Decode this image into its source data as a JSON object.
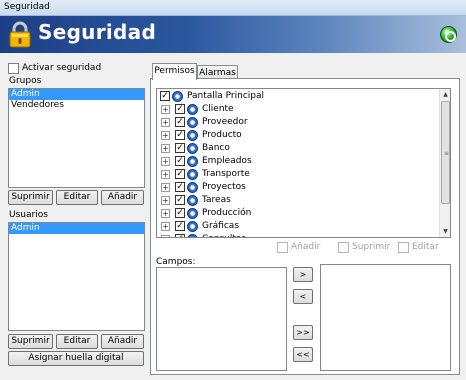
{
  "window": {
    "title": "Seguridad"
  },
  "banner": {
    "title": "Seguridad",
    "lock_icon": "padlock-icon",
    "status_icon": "power-status-icon",
    "status_color": "#1a9b1a"
  },
  "left": {
    "activar_label": "Activar seguridad",
    "activar_checked": false,
    "grupos_label": "Grupos",
    "grupos": [
      {
        "name": "Admin",
        "selected": true
      },
      {
        "name": "Vendedores",
        "selected": false
      }
    ],
    "grupos_buttons": {
      "suprimir": "Suprimir",
      "editar": "Editar",
      "anadir": "Añadir"
    },
    "usuarios_label": "Usuarios",
    "usuarios": [
      {
        "name": "Admin",
        "selected": true
      }
    ],
    "usuarios_buttons": {
      "suprimir": "Suprimir",
      "editar": "Editar",
      "anadir": "Añadir"
    },
    "huella_button": "Asignar huella digital"
  },
  "tabs": [
    {
      "label": "Permisos",
      "active": true
    },
    {
      "label": "Alarmas",
      "active": false
    }
  ],
  "tree": {
    "root": {
      "label": "Pantalla Principal",
      "checked": true
    },
    "items": [
      {
        "label": "Cliente",
        "checked": true
      },
      {
        "label": "Proveedor",
        "checked": true
      },
      {
        "label": "Producto",
        "checked": true
      },
      {
        "label": "Banco",
        "checked": true
      },
      {
        "label": "Empleados",
        "checked": true
      },
      {
        "label": "Transporte",
        "checked": true
      },
      {
        "label": "Proyectos",
        "checked": true
      },
      {
        "label": "Tareas",
        "checked": true
      },
      {
        "label": "Producción",
        "checked": true
      },
      {
        "label": "Gráficas",
        "checked": true
      },
      {
        "label": "Consultas",
        "checked": true
      }
    ]
  },
  "options": {
    "anadir": "Añadir",
    "suprimir": "Suprimir",
    "editar": "Editar"
  },
  "campos": {
    "label": "Campos:",
    "move_right": ">",
    "move_left": "<",
    "move_all_right": ">>",
    "move_all_left": "<<"
  },
  "colors": {
    "selection": "#3399ff",
    "banner_dark": "#1d3f86"
  }
}
